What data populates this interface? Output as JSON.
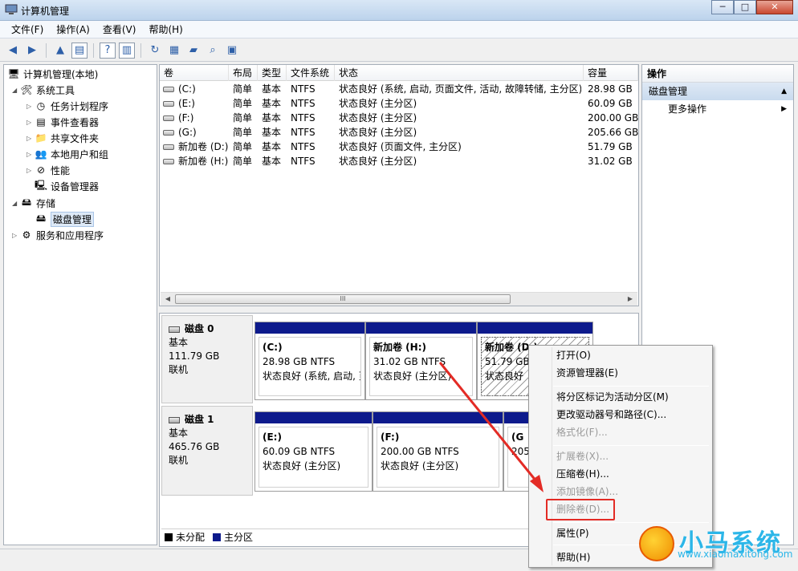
{
  "window": {
    "title": "计算机管理",
    "buttons": [
      "─",
      "□",
      "✕"
    ]
  },
  "menu": [
    "文件(F)",
    "操作(A)",
    "查看(V)",
    "帮助(H)"
  ],
  "tree": {
    "root": "计算机管理(本地)",
    "system_tools": "系统工具",
    "task_scheduler": "任务计划程序",
    "event_viewer": "事件查看器",
    "shared_folders": "共享文件夹",
    "local_users": "本地用户和组",
    "performance": "性能",
    "device_manager": "设备管理器",
    "storage": "存储",
    "disk_management": "磁盘管理",
    "services_apps": "服务和应用程序"
  },
  "volumes": {
    "headers": [
      "卷",
      "布局",
      "类型",
      "文件系统",
      "状态",
      "容量"
    ],
    "rows": [
      [
        "(C:)",
        "简单",
        "基本",
        "NTFS",
        "状态良好 (系统, 启动, 页面文件, 活动, 故障转储, 主分区)",
        "28.98 GB"
      ],
      [
        "(E:)",
        "简单",
        "基本",
        "NTFS",
        "状态良好 (主分区)",
        "60.09 GB"
      ],
      [
        "(F:)",
        "简单",
        "基本",
        "NTFS",
        "状态良好 (主分区)",
        "200.00 GB"
      ],
      [
        "(G:)",
        "简单",
        "基本",
        "NTFS",
        "状态良好 (主分区)",
        "205.66 GB"
      ],
      [
        "新加卷 (D:)",
        "简单",
        "基本",
        "NTFS",
        "状态良好 (页面文件, 主分区)",
        "51.79 GB"
      ],
      [
        "新加卷 (H:)",
        "简单",
        "基本",
        "NTFS",
        "状态良好 (主分区)",
        "31.02 GB"
      ]
    ],
    "scroll_grip": "III"
  },
  "disks": [
    {
      "name": "磁盘 0",
      "type": "基本",
      "size": "111.79 GB",
      "status": "联机",
      "partitions": [
        {
          "name": "(C:)",
          "size": "28.98 GB NTFS",
          "status": "状态良好 (系统, 启动, 页"
        },
        {
          "name": "新加卷  (H:)",
          "size": "31.02 GB NTFS",
          "status": "状态良好 (主分区)"
        },
        {
          "name": "新加卷  (D:)",
          "size": "51.79 GB",
          "status": "状态良好"
        }
      ]
    },
    {
      "name": "磁盘 1",
      "type": "基本",
      "size": "465.76 GB",
      "status": "联机",
      "partitions": [
        {
          "name": "(E:)",
          "size": "60.09 GB NTFS",
          "status": "状态良好 (主分区)"
        },
        {
          "name": "(F:)",
          "size": "200.00 GB NTFS",
          "status": "状态良好 (主分区)"
        },
        {
          "name": "(G",
          "size": "205",
          "status": ""
        }
      ]
    }
  ],
  "legend": {
    "unallocated": "未分配",
    "primary": "主分区",
    "unallocated_color": "#000000",
    "primary_color": "#0d1a8c"
  },
  "actions": {
    "header": "操作",
    "section": "磁盘管理",
    "more": "更多操作"
  },
  "context_menu": {
    "open": "打开(O)",
    "explorer": "资源管理器(E)",
    "mark_active": "将分区标记为活动分区(M)",
    "change_letter": "更改驱动器号和路径(C)...",
    "format": "格式化(F)...",
    "extend": "扩展卷(X)...",
    "shrink": "压缩卷(H)...",
    "add_mirror": "添加镜像(A)...",
    "delete": "删除卷(D)...",
    "properties": "属性(P)",
    "help": "帮助(H)"
  },
  "watermark": {
    "brand": "小马系统",
    "url": "www.xiaomaxitong.com"
  },
  "colors": {
    "accent_red": "#e32b25",
    "partition_bar": "#0d1a8c",
    "watermark": "#2cb6e8"
  }
}
